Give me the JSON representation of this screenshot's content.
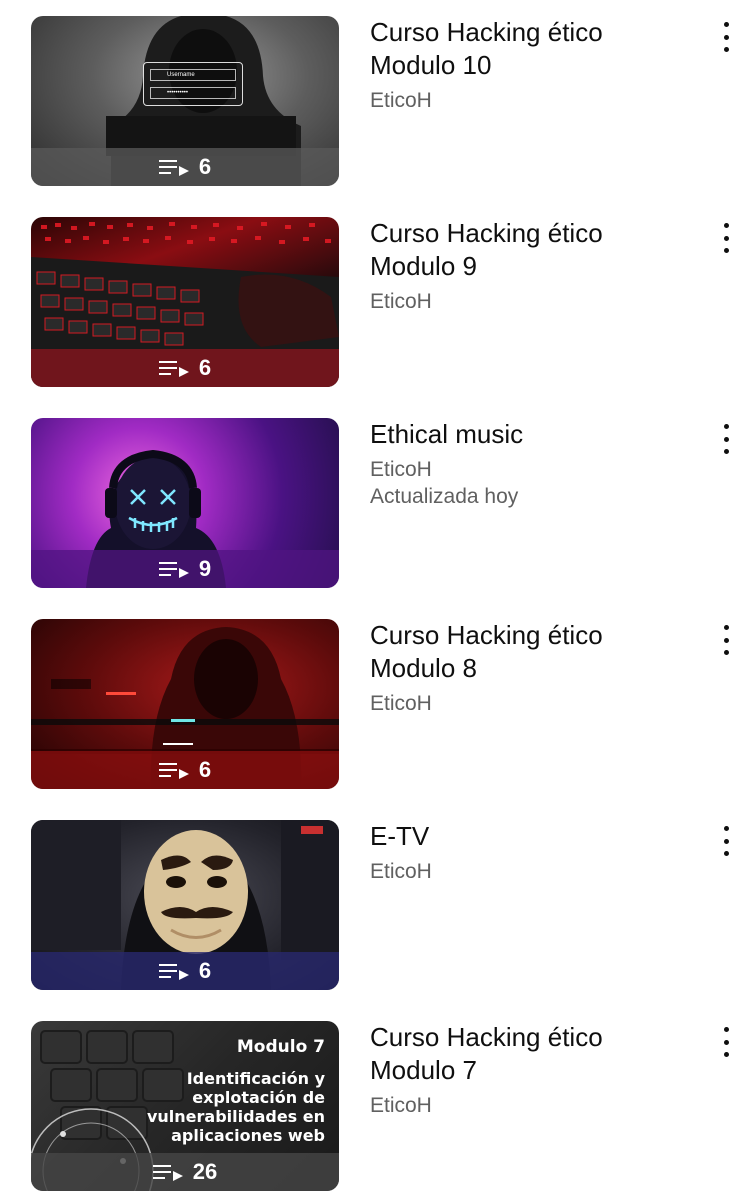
{
  "playlists": [
    {
      "title_line1": "Curso Hacking ético",
      "title_line2": "Modulo 10",
      "channel": "EticoH",
      "updated": "",
      "count": "6"
    },
    {
      "title_line1": "Curso Hacking ético",
      "title_line2": "Modulo 9",
      "channel": "EticoH",
      "updated": "",
      "count": "6"
    },
    {
      "title_line1": "Ethical music",
      "title_line2": "",
      "channel": "EticoH",
      "updated": "Actualizada hoy",
      "count": "9"
    },
    {
      "title_line1": "Curso Hacking ético",
      "title_line2": "Modulo 8",
      "channel": "EticoH",
      "updated": "",
      "count": "6"
    },
    {
      "title_line1": "E-TV",
      "title_line2": "",
      "channel": "EticoH",
      "updated": "",
      "count": "6"
    },
    {
      "title_line1": "Curso Hacking ético",
      "title_line2": "Modulo 7",
      "channel": "EticoH",
      "updated": "",
      "count": "26"
    }
  ],
  "thumb1": {
    "username_label": "Username",
    "password_mask": "••••••••••"
  },
  "thumb6": {
    "heading": "Modulo 7",
    "line1": "Identificación y",
    "line2": "explotación de",
    "line3": "vulnerabilidades en",
    "line4": "aplicaciones web"
  },
  "icons": {
    "playlist": "playlist-icon",
    "more": "more-vert-icon"
  }
}
